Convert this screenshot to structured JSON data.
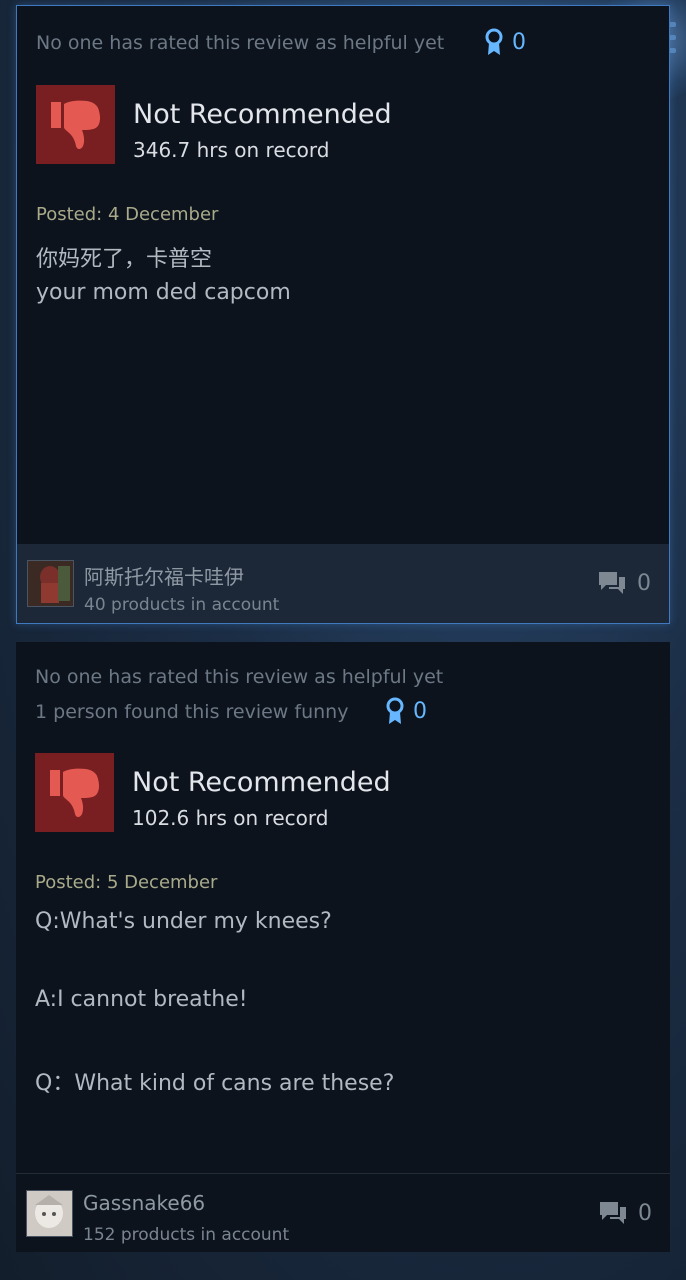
{
  "reviews": [
    {
      "helpful_text": "No one has rated this review as helpful yet",
      "funny_text": "",
      "award_count": "0",
      "verdict": "Not Recommended",
      "hours": "346.7 hrs on record",
      "posted": "Posted: 4 December",
      "body": [
        "你妈死了，卡普空",
        "your mom ded capcom"
      ],
      "username": "阿斯托尔福卡哇伊",
      "products": "40 products in account",
      "comment_count": "0"
    },
    {
      "helpful_text": "No one has rated this review as helpful yet",
      "funny_text": "1 person found this review funny",
      "award_count": "0",
      "verdict": "Not Recommended",
      "hours": "102.6 hrs on record",
      "posted": "Posted: 5 December",
      "body": [
        "Q:What's under my knees?",
        "A:I cannot breathe!",
        "Q：What kind of cans are these?"
      ],
      "username": "Gassnake66",
      "products": "152 products in account",
      "comment_count": "0"
    }
  ],
  "colors": {
    "accent_blue": "#66b7ff",
    "thumb_bg": "#7a1f21",
    "thumb_icon": "#e45a52",
    "selected_border": "#3f7ac0"
  },
  "icons": {
    "menu": "menu-icon",
    "award": "award-icon",
    "thumb": "thumbs-down-icon",
    "comment": "comment-icon"
  }
}
